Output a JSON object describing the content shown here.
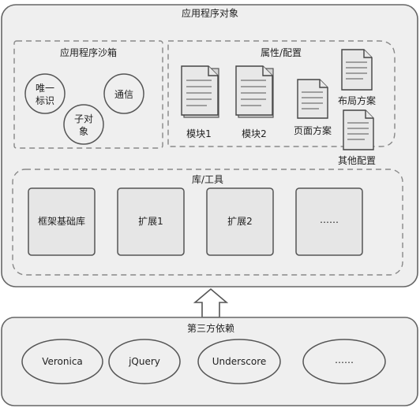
{
  "app_object": {
    "title": "应用程序对象"
  },
  "sandbox": {
    "title": "应用程序沙箱",
    "items": [
      "唯一\n标识",
      "子对\n象",
      "通信"
    ]
  },
  "config": {
    "title": "属性/配置",
    "docs": [
      "模块1",
      "模块2",
      "页面方案",
      "布局方案",
      "其他配置"
    ]
  },
  "library": {
    "title": "库/工具",
    "items": [
      "框架基础库",
      "扩展1",
      "扩展2",
      "……"
    ]
  },
  "third_party": {
    "title": "第三方依赖",
    "items": [
      "Veronica",
      "jQuery",
      "Underscore",
      "……"
    ]
  }
}
